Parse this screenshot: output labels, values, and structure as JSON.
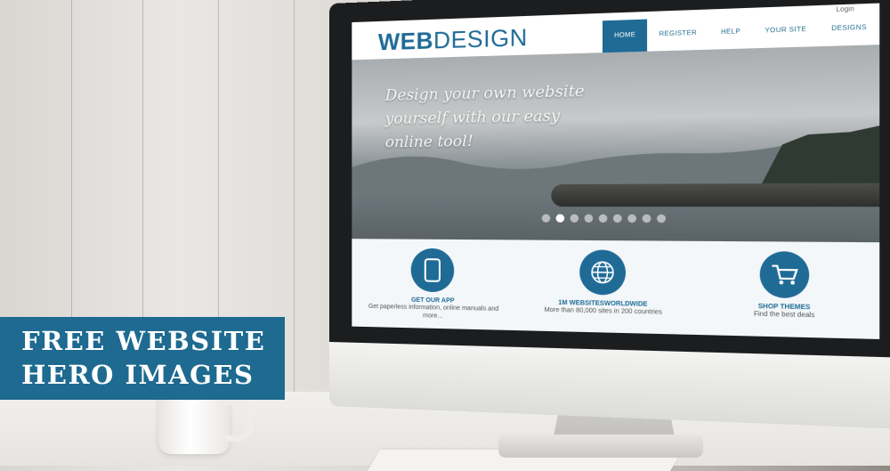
{
  "banner": {
    "line1": "FREE WEBSITE",
    "line2": "HERO IMAGES",
    "color": "#1e6a90"
  },
  "site": {
    "logo_bold": "WEB",
    "logo_regular": "DESIGN",
    "login": "Login",
    "nav": [
      "HOME",
      "REGISTER",
      "HELP",
      "YOUR SITE",
      "DESIGNS"
    ],
    "active_nav": "HOME",
    "hero_text": "Design your own website yourself with our easy online tool!",
    "slider_dots": 9,
    "active_dot": 2,
    "features": [
      {
        "title": "GET OUR APP",
        "sub": "Get paperless information, online manuals and more...",
        "icon": "tablet-icon"
      },
      {
        "title": "1M WEBSITESWORLDWIDE",
        "sub": "More than 80,000 sites in 200 countries",
        "icon": "globe-icon"
      },
      {
        "title": "SHOP THEMES",
        "sub": "Find the best deals",
        "icon": "cart-icon"
      }
    ],
    "accent": "#1f6b96"
  }
}
